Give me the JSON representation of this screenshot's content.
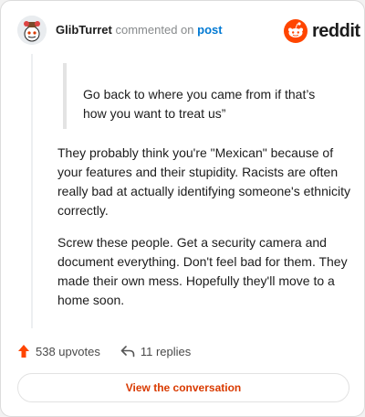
{
  "comment": {
    "author": "GlibTurret",
    "action_text": "commented on",
    "target_link": "post"
  },
  "brand": {
    "name": "reddit",
    "accent": "#ff4500"
  },
  "quote": {
    "text": "Go back to where you came from if that’s how you want to treat us”"
  },
  "body": {
    "paragraphs": [
      "They probably think you're \"Mexican\" because of your features and their stupidity. Racists are often really bad at actually identifying someone's ethnicity correctly.",
      "Screw these people. Get a security camera and document everything. Don't feel bad for them. They made their own mess. Hopefully they'll move to a home soon."
    ]
  },
  "stats": {
    "upvotes": "538 upvotes",
    "replies": "11 replies"
  },
  "cta": {
    "label": "View the conversation"
  },
  "icons": {
    "avatar": "snoo-avatar-icon",
    "logo": "reddit-logo-icon",
    "upvote": "upvote-arrow-icon",
    "reply": "reply-arrow-icon"
  }
}
